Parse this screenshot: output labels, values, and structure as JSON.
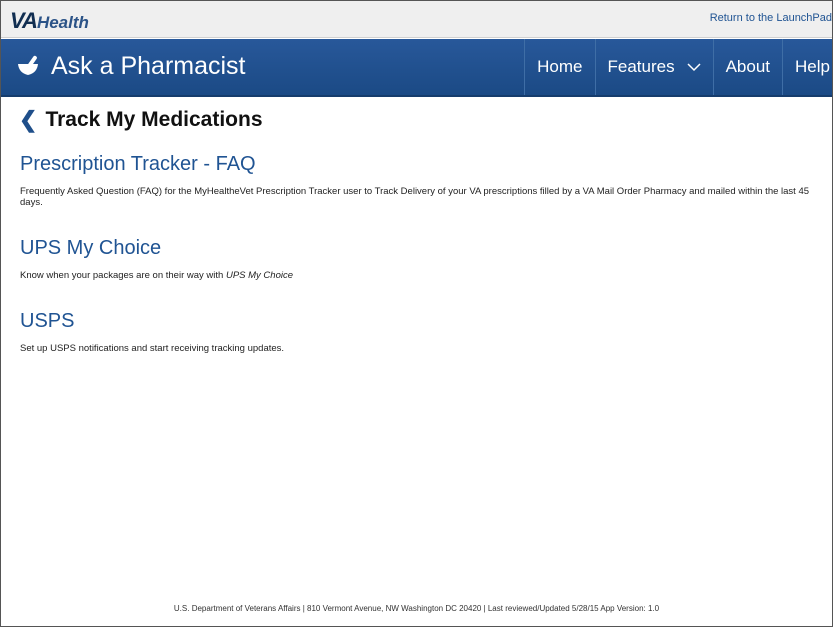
{
  "top_bar": {
    "logo_va": "VA",
    "logo_health": "Health",
    "launchpad_link": "Return to the LaunchPad"
  },
  "nav": {
    "app_title": "Ask a Pharmacist",
    "app_icon": "mortar-pestle-icon",
    "links": [
      {
        "label": "Home"
      },
      {
        "label": "Features",
        "icon": "chevron-down-icon"
      },
      {
        "label": "About"
      },
      {
        "label": "Help"
      }
    ]
  },
  "page": {
    "title": "Track My Medications",
    "back_icon": "chevron-left-icon"
  },
  "sections": [
    {
      "title": "Prescription Tracker - FAQ",
      "description": "Frequently Asked Question (FAQ) for the MyHealtheVet Prescription Tracker user to Track Delivery of your VA prescriptions filled by a VA Mail Order Pharmacy and mailed within the last 45 days."
    },
    {
      "title": "UPS My Choice",
      "description_prefix": "Know when your packages are on their way with ",
      "description_emph": "UPS My Choice"
    },
    {
      "title": "USPS",
      "description": "Set up USPS notifications and start receiving tracking updates."
    }
  ],
  "footer": {
    "text": "U.S. Department of Veterans Affairs | 810 Vermont Avenue, NW Washington DC 20420 | Last reviewed/Updated 5/28/15 App Version: 1.0"
  },
  "colors": {
    "nav_bg": "#1f4f8a",
    "link": "#205493",
    "topbar_bg": "#efefef"
  }
}
